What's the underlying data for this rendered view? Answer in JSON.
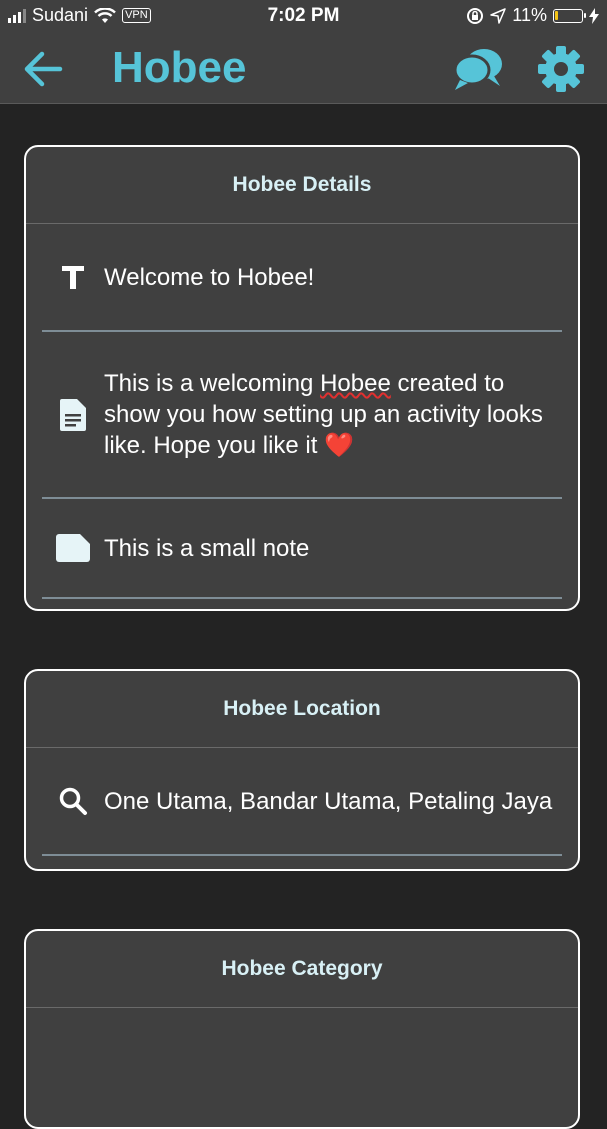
{
  "status_bar": {
    "carrier": "Sudani",
    "vpn": "VPN",
    "time": "7:02 PM",
    "battery": "11%",
    "battery_level": 0.11
  },
  "app_bar": {
    "title": "Hobee",
    "back_icon": "arrow-left-icon",
    "chat_icon": "chat-bubbles-icon",
    "settings_icon": "gear-icon"
  },
  "details": {
    "header": "Hobee Details",
    "title": "Welcome to Hobee!",
    "description_before": "This is a welcoming ",
    "description_word": "Hobee",
    "description_after": " created to show you how setting up an activity looks like. Hope you like it ❤️",
    "note": "This is a small note"
  },
  "location": {
    "header": "Hobee Location",
    "value": "One Utama, Bandar Utama, Petaling Jaya"
  },
  "category": {
    "header": "Hobee Category"
  },
  "colors": {
    "accent": "#56c4d8",
    "header_text": "#d8f0f5",
    "background": "#232323",
    "card": "#404040"
  }
}
